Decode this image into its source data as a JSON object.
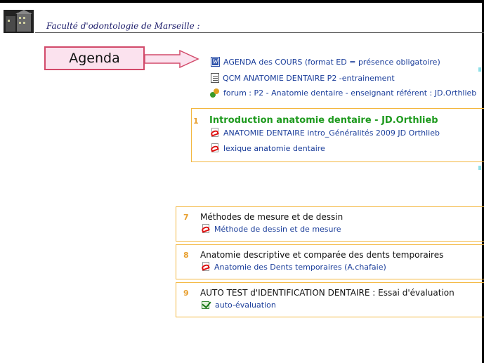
{
  "header": {
    "faculty_title": "Faculté d'odontologie de Marseille :"
  },
  "callout": {
    "label": "Agenda"
  },
  "top_resources": [
    {
      "label": "AGENDA des COURS (format ED = présence obligatoire)",
      "icon": "word-document-icon"
    },
    {
      "label": "QCM ANATOMIE DENTAIRE P2 -entrainement",
      "icon": "quiz-icon"
    },
    {
      "label": "forum : P2 - Anatomie dentaire - enseignant référent : JD.Orthlieb",
      "icon": "forum-icon"
    }
  ],
  "sections": [
    {
      "number": "1",
      "title": "Introduction anatomie dentaire - JD.Orthlieb",
      "resources": [
        {
          "label": "ANATOMIE DENTAIRE intro_Généralités 2009 JD Orthlieb",
          "icon": "pdf-icon"
        },
        {
          "label": "lexique anatomie dentaire",
          "icon": "pdf-icon"
        }
      ]
    },
    {
      "number": "7",
      "title": "Méthodes de mesure et de dessin",
      "resources": [
        {
          "label": "Méthode de dessin et de mesure",
          "icon": "pdf-icon"
        }
      ]
    },
    {
      "number": "8",
      "title": "Anatomie descriptive et comparée des dents temporaires",
      "resources": [
        {
          "label": "Anatomie des Dents temporaires (A.chafaie)",
          "icon": "pdf-icon"
        }
      ]
    },
    {
      "number": "9",
      "title": "AUTO TEST d'IDENTIFICATION DENTAIRE : Essai d'évaluation",
      "resources": [
        {
          "label": "auto-évaluation",
          "icon": "quiz-check-icon"
        }
      ]
    }
  ],
  "colors": {
    "link": "#1a3d9a",
    "section_border": "#f3b73f",
    "section_number": "#e8a030",
    "highlight_title": "#1e9a1e",
    "callout_fill": "#fbe2ee",
    "callout_border": "#d24a6a"
  }
}
